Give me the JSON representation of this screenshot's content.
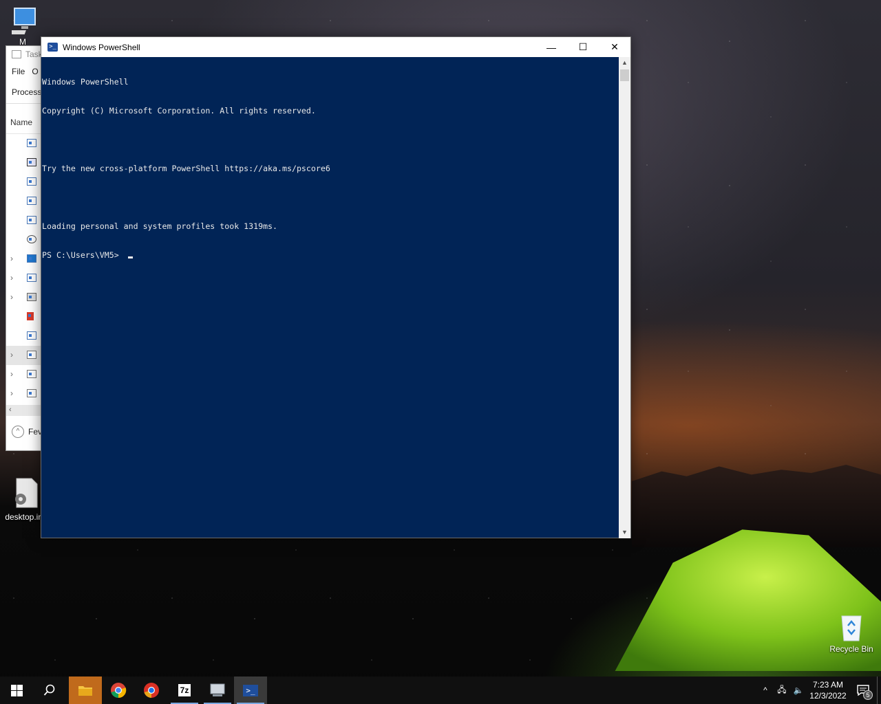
{
  "desktop": {
    "icons": [
      {
        "label": "M"
      },
      {
        "label": "desktop.ini"
      },
      {
        "label": "Recycle Bin"
      }
    ]
  },
  "task_manager": {
    "title": "Task",
    "menu": [
      "File",
      "O"
    ],
    "tab": "Process",
    "column_header": "Name",
    "fewer_details": "Fev"
  },
  "powershell": {
    "title": "Windows PowerShell",
    "lines": [
      "Windows PowerShell",
      "Copyright (C) Microsoft Corporation. All rights reserved.",
      "",
      "Try the new cross-platform PowerShell https://aka.ms/pscore6",
      "",
      "Loading personal and system profiles took 1319ms.",
      "PS C:\\Users\\VM5> "
    ],
    "buttons": {
      "minimize": "—",
      "maximize": "☐",
      "close": "✕"
    }
  },
  "taskbar": {
    "apps": [
      "Start",
      "Search",
      "File Explorer",
      "Google Chrome",
      "Chromium",
      "7-Zip",
      "App",
      "Windows PowerShell"
    ],
    "tray": {
      "time": "7:23 AM",
      "date": "12/3/2022",
      "notification_count": "5"
    }
  }
}
